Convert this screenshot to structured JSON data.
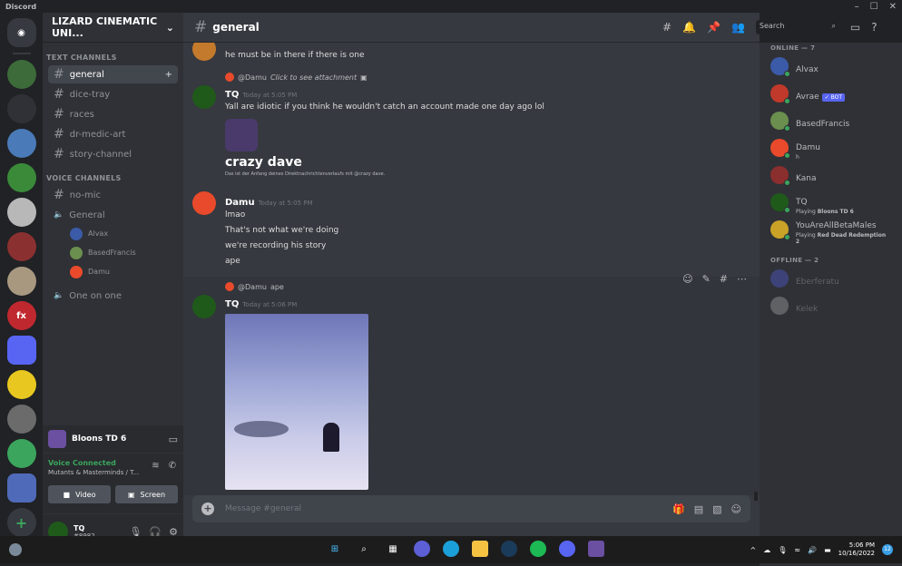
{
  "titlebar": {
    "app": "Discord",
    "min": "–",
    "max": "☐",
    "close": "✕"
  },
  "server": {
    "name": "LIZARD CINEMATIC UNI...",
    "chevron": "⌄"
  },
  "sidebar": {
    "text_header": "TEXT CHANNELS",
    "text_channels": [
      {
        "name": "general",
        "active": true
      },
      {
        "name": "dice-tray"
      },
      {
        "name": "races"
      },
      {
        "name": "dr-medic-art"
      },
      {
        "name": "story-channel"
      }
    ],
    "voice_header": "VOICE CHANNELS",
    "voice_channels": [
      {
        "name": "no-mic",
        "hash": true
      },
      {
        "name": "General"
      },
      {
        "name": "One on one"
      }
    ],
    "voice_users": [
      "Alvax",
      "BasedFrancis",
      "Damu"
    ]
  },
  "activity": {
    "game": "Bloons TD 6"
  },
  "voice": {
    "status": "Voice Connected",
    "sub": "Mutants & Masterminds / T...",
    "video_label": "Video",
    "screen_label": "Screen"
  },
  "user_panel": {
    "name": "TQ",
    "tag": "#8982"
  },
  "channel": {
    "name": "general",
    "search_placeholder": "Search"
  },
  "messages": [
    {
      "kind": "partial",
      "text": "he must be in there if there is one"
    },
    {
      "kind": "reply",
      "reply_to": "@Damu",
      "reply_text": "Click to see attachment",
      "author": "TQ",
      "time": "Today at 5:05 PM",
      "text": "Yall are idiotic if you think he wouldn't catch an account made one day ago lol",
      "embed_title": "crazy dave",
      "embed_sub": "Das ist der Anfang deines Direktnachrichtenverlaufs mit @crazy dave."
    },
    {
      "kind": "normal",
      "author": "Damu",
      "time": "Today at 5:05 PM",
      "lines": [
        "lmao",
        "That's not what we're doing",
        "we're recording his story",
        "ape"
      ]
    },
    {
      "kind": "reply",
      "reply_to": "@Damu",
      "reply_text": "ape",
      "author": "TQ",
      "time": "Today at 5:06 PM"
    }
  ],
  "composer": {
    "placeholder": "Message #general"
  },
  "members": {
    "online_header": "ONLINE — 7",
    "online": [
      {
        "name": "Alvax",
        "color": "#3b5aa8"
      },
      {
        "name": "Avrae",
        "bot": "✓ BOT",
        "color": "#c0392b"
      },
      {
        "name": "BasedFrancis",
        "color": "#6b8f4e"
      },
      {
        "name": "Damu",
        "status": "h",
        "color": "#e84a2b"
      },
      {
        "name": "Kana",
        "color": "#8b2e2e"
      },
      {
        "name": "TQ",
        "status_prefix": "Playing",
        "status_game": "Bloons TD 6",
        "color": "#1f5a1a"
      },
      {
        "name": "YouAreAllBetaMales",
        "status_prefix": "Playing",
        "status_game": "Red Dead Redemption 2",
        "color": "#c9a227"
      }
    ],
    "offline_header": "OFFLINE — 2",
    "offline": [
      {
        "name": "Eberferatu",
        "color": "#5865f2"
      },
      {
        "name": "Kelek",
        "color": "#b9bbbe"
      }
    ]
  },
  "taskbar": {
    "time": "5:06 PM",
    "date": "10/16/2022",
    "notifications": "12"
  }
}
